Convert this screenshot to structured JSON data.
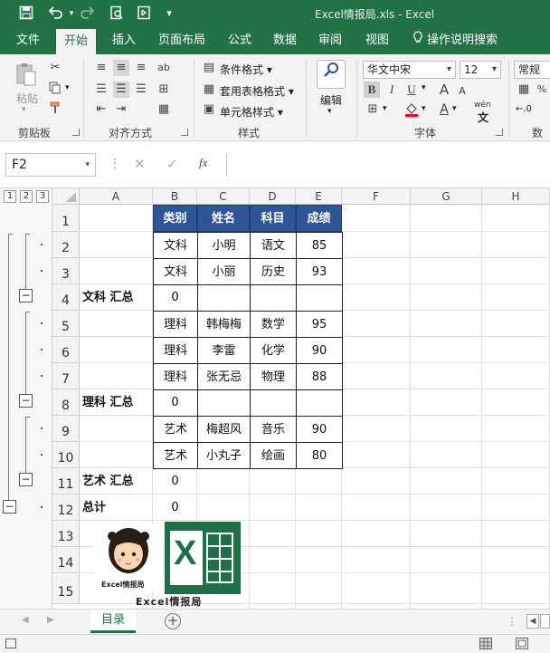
{
  "window": {
    "title": "Excel情报局.xls  -  Excel"
  },
  "quick_access": {
    "save_icon": "save-icon",
    "undo_icon": "undo-icon",
    "redo_icon": "redo-icon",
    "print_preview_icon": "print-preview-icon",
    "touch_icon": "touch-mode-icon",
    "customize_icon": "customize-icon"
  },
  "tabs": [
    "文件",
    "开始",
    "插入",
    "页面布局",
    "公式",
    "数据",
    "审阅",
    "视图",
    "操作说明搜索"
  ],
  "ribbon": {
    "clipboard": {
      "paste_label": "粘贴",
      "group_label": "剪贴板"
    },
    "alignment": {
      "group_label": "对齐方式"
    },
    "styles": {
      "conditional": "条件格式",
      "table": "套用表格格式",
      "cell": "单元格样式",
      "group_label": "样式"
    },
    "editing": {
      "label": "编辑"
    },
    "font": {
      "name": "华文中宋",
      "size": "12",
      "bold": "B",
      "italic": "I",
      "underline": "U",
      "grow": "A",
      "shrink": "A",
      "wen": "wén",
      "group_label": "字体"
    },
    "number": {
      "format": "常规",
      "group_label": "数字"
    }
  },
  "formula_bar": {
    "name_box": "F2",
    "fx": "fx",
    "value": ""
  },
  "outline_levels": [
    "1",
    "2",
    "3"
  ],
  "columns": [
    "A",
    "B",
    "C",
    "D",
    "E",
    "F",
    "G",
    "H"
  ],
  "rows": [
    "1",
    "2",
    "3",
    "4",
    "5",
    "6",
    "7",
    "8",
    "9",
    "10",
    "11",
    "12",
    "13",
    "14",
    "15"
  ],
  "table": {
    "headers": [
      "类别",
      "姓名",
      "科目",
      "成绩"
    ],
    "data_rows": [
      {
        "row": 2,
        "cells": [
          "文科",
          "小明",
          "语文",
          "85"
        ]
      },
      {
        "row": 3,
        "cells": [
          "文科",
          "小丽",
          "历史",
          "93"
        ]
      },
      {
        "row": 5,
        "cells": [
          "理科",
          "韩梅梅",
          "数学",
          "95"
        ]
      },
      {
        "row": 6,
        "cells": [
          "理科",
          "李雷",
          "化学",
          "90"
        ]
      },
      {
        "row": 7,
        "cells": [
          "理科",
          "张无忌",
          "物理",
          "88"
        ]
      },
      {
        "row": 9,
        "cells": [
          "艺术",
          "梅超风",
          "音乐",
          "90"
        ]
      },
      {
        "row": 10,
        "cells": [
          "艺术",
          "小丸子",
          "绘画",
          "80"
        ]
      }
    ],
    "subtotals": [
      {
        "row": 4,
        "label": "文科 汇总",
        "value": "0"
      },
      {
        "row": 8,
        "label": "理科 汇总",
        "value": "0"
      },
      {
        "row": 11,
        "label": "艺术 汇总",
        "value": "0"
      },
      {
        "row": 12,
        "label": "总计",
        "value": "0"
      }
    ]
  },
  "logo": {
    "avatar_caption": "Excel情报局",
    "brand": "Excel情报局",
    "letter": "X"
  },
  "sheets": {
    "active": "目录",
    "add_icon": "add-sheet-icon"
  }
}
